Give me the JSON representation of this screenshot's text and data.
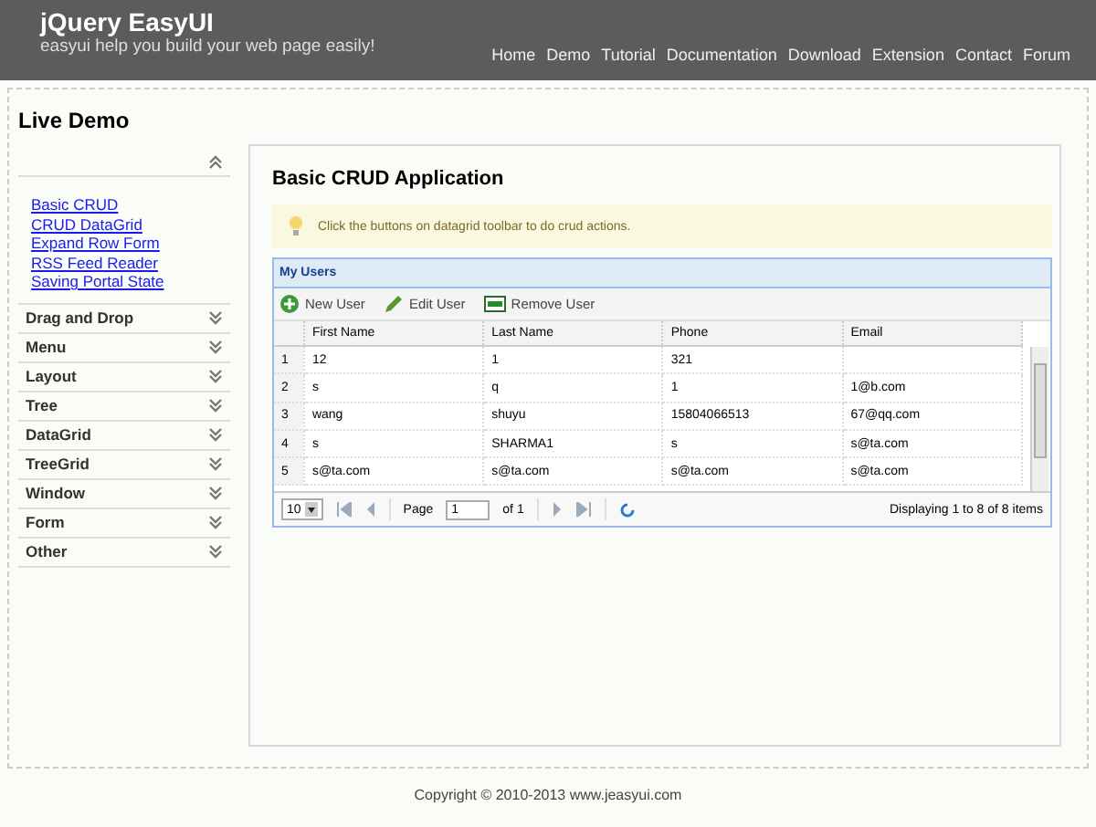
{
  "header": {
    "title": "jQuery EasyUI",
    "subtitle": "easyui help you build your web page easily!",
    "nav": [
      "Home",
      "Demo",
      "Tutorial",
      "Documentation",
      "Download",
      "Extension",
      "Contact",
      "Forum"
    ]
  },
  "page_title": "Live Demo",
  "sidebar": {
    "sections": [
      {
        "expanded": true,
        "links": [
          "Basic CRUD",
          "CRUD DataGrid",
          "Expand Row Form",
          "RSS Feed Reader",
          "Saving Portal State"
        ]
      },
      {
        "title": "Drag and Drop",
        "expanded": false
      },
      {
        "title": "Menu",
        "expanded": false
      },
      {
        "title": "Layout",
        "expanded": false
      },
      {
        "title": "Tree",
        "expanded": false
      },
      {
        "title": "DataGrid",
        "expanded": false
      },
      {
        "title": "TreeGrid",
        "expanded": false
      },
      {
        "title": "Window",
        "expanded": false
      },
      {
        "title": "Form",
        "expanded": false
      },
      {
        "title": "Other",
        "expanded": false
      }
    ]
  },
  "demo": {
    "title": "Basic CRUD Application",
    "tip": "Click the buttons on datagrid toolbar to do crud actions.",
    "grid": {
      "title": "My Users",
      "toolbar": [
        {
          "kind": "add",
          "label": "New User"
        },
        {
          "kind": "edit",
          "label": "Edit User"
        },
        {
          "kind": "remove",
          "label": "Remove User"
        }
      ],
      "columns": [
        "First Name",
        "Last Name",
        "Phone",
        "Email"
      ],
      "rows": [
        {
          "num": "1",
          "cells": [
            "12",
            "1",
            "321",
            ""
          ]
        },
        {
          "num": "2",
          "cells": [
            "s",
            "q",
            "1",
            "1@b.com"
          ]
        },
        {
          "num": "3",
          "cells": [
            "wang",
            "shuyu",
            "15804066513",
            "67@qq.com"
          ]
        },
        {
          "num": "4",
          "cells": [
            "s",
            "SHARMA1",
            "s",
            "s@ta.com"
          ]
        },
        {
          "num": "5",
          "cells": [
            "s@ta.com",
            "s@ta.com",
            "s@ta.com",
            "s@ta.com"
          ]
        }
      ],
      "pager": {
        "page_size": "10",
        "page_label": "Page",
        "page": "1",
        "of": "of 1",
        "summary": "Displaying 1 to 8 of 8 items"
      }
    }
  },
  "footer": "Copyright © 2010-2013 www.jeasyui.com"
}
